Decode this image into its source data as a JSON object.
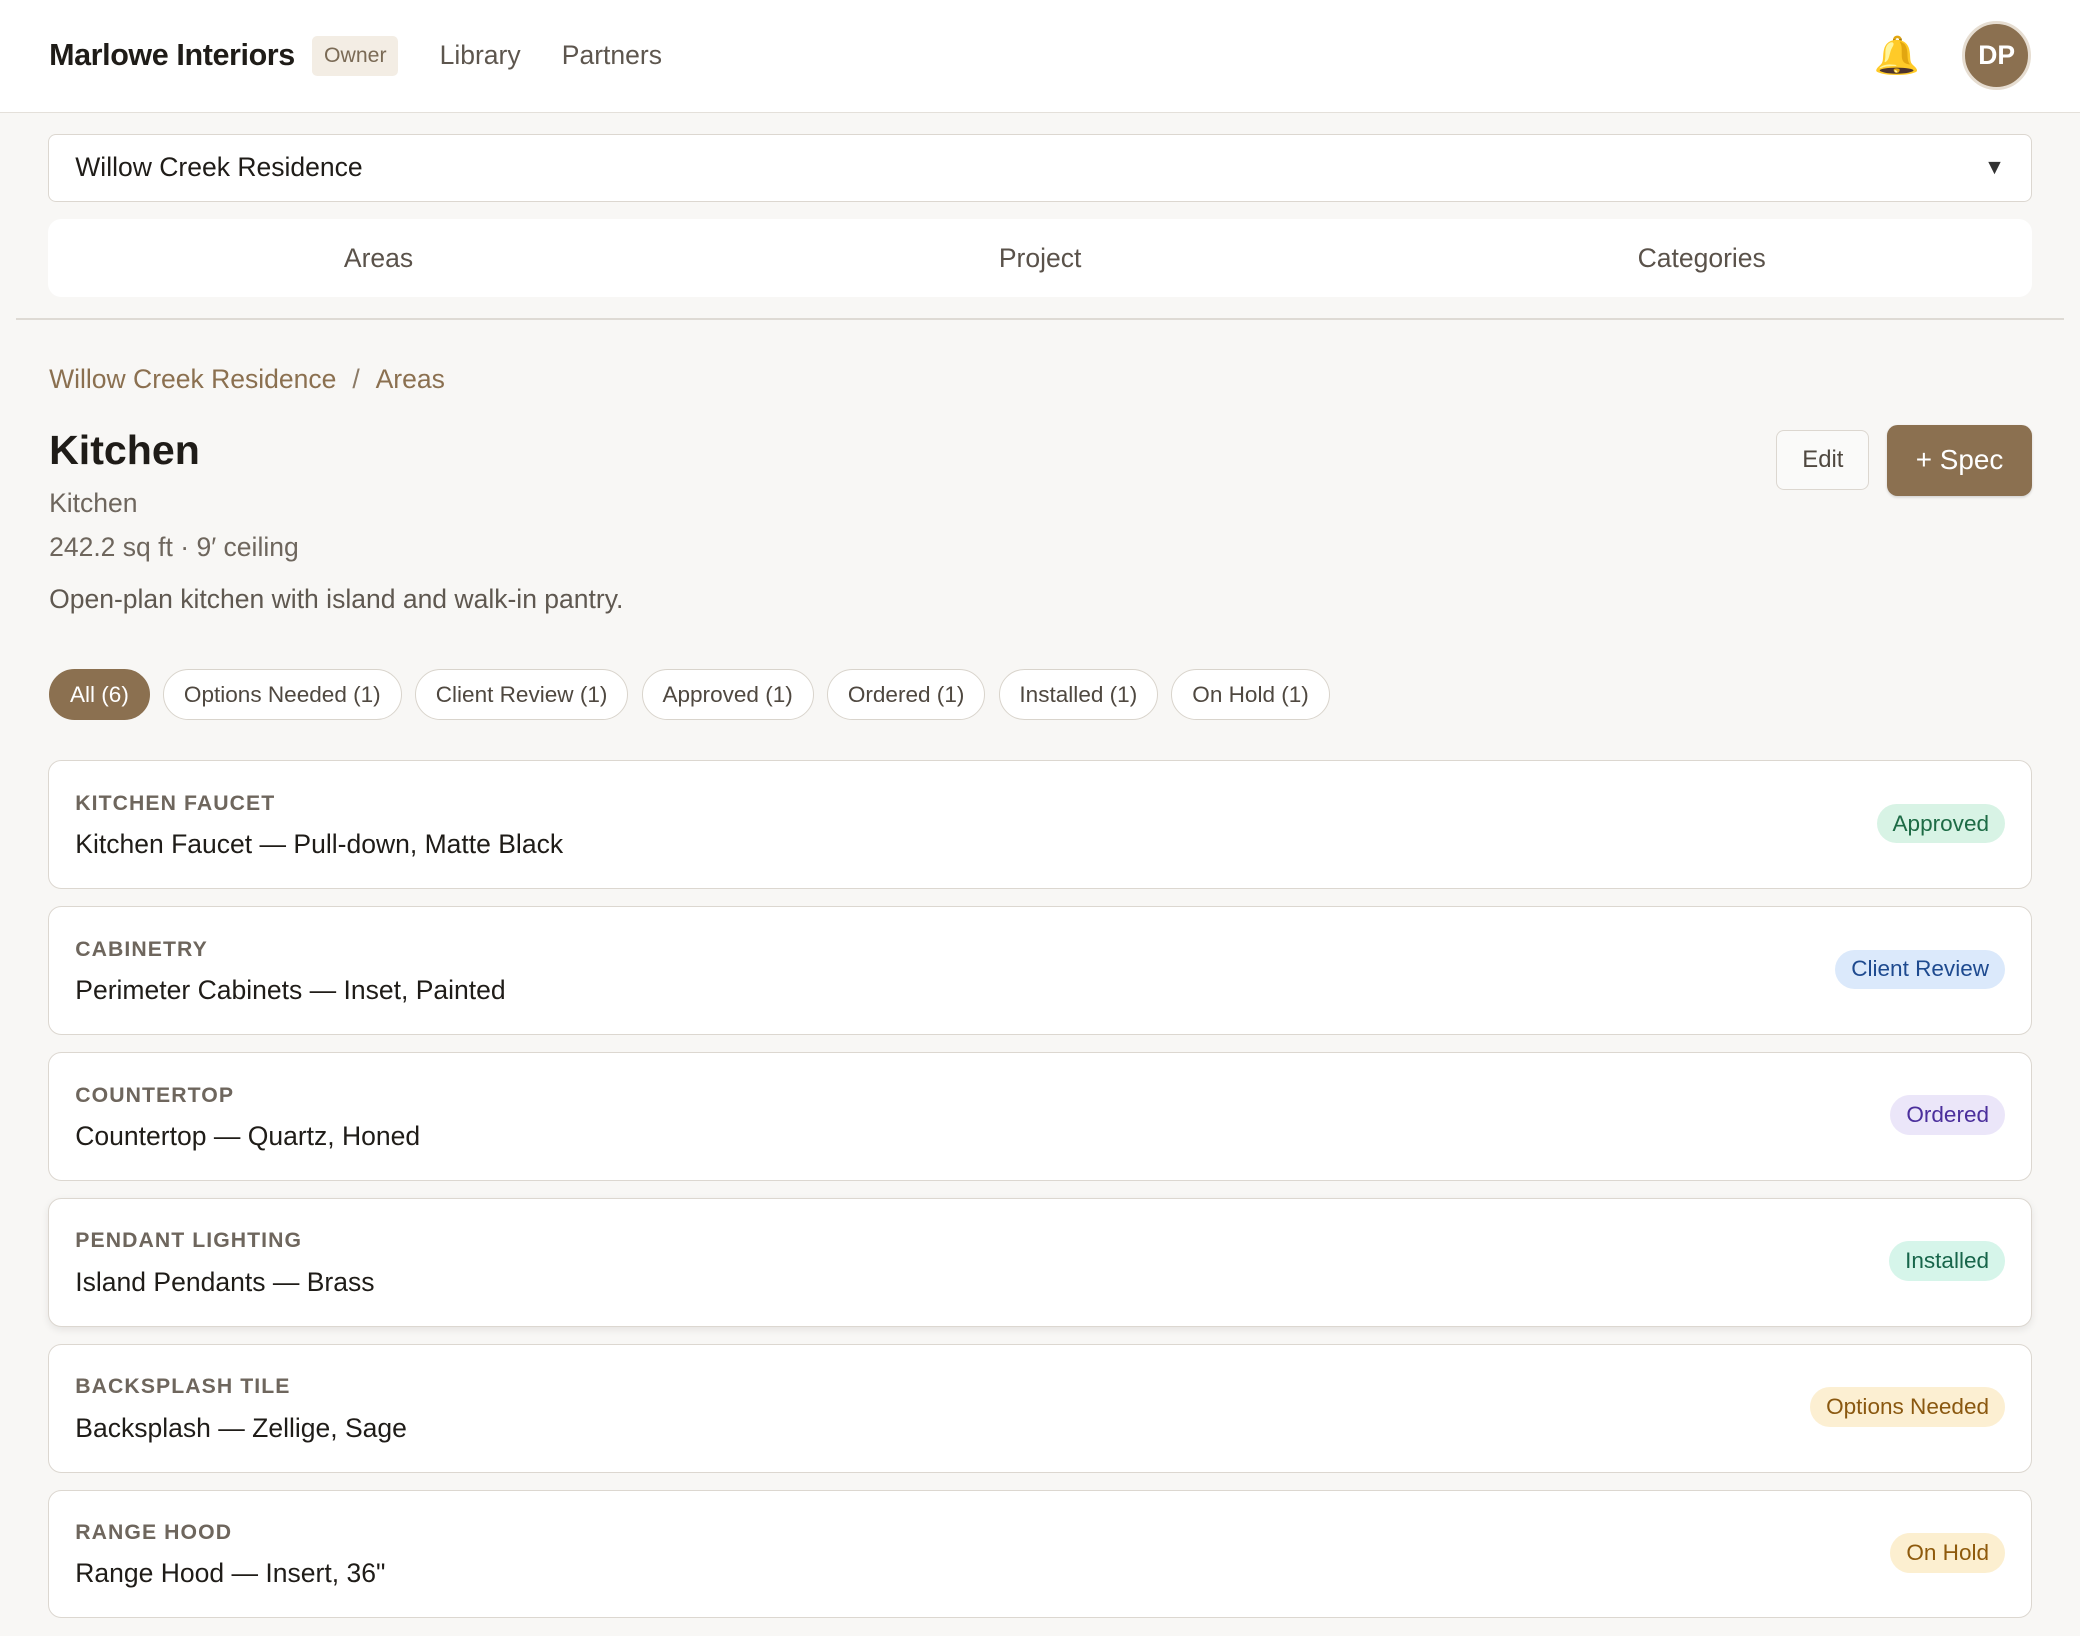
{
  "app": {
    "brand": "Marlowe Interiors",
    "role": "Owner",
    "nav": [
      "Library",
      "Partners"
    ],
    "avatar_initials": "DP",
    "bell_icon": "bell-icon"
  },
  "project_selector": {
    "value": "Willow Creek Residence",
    "caret_icon": "chevron-down-icon"
  },
  "tabs": [
    "Areas",
    "Project",
    "Categories"
  ],
  "breadcrumb": {
    "project": "Willow Creek Residence",
    "separator": "/",
    "section": "Areas"
  },
  "area": {
    "title": "Kitchen",
    "type": "Kitchen",
    "dimensions": "242.2 sq ft · 9′ ceiling",
    "description": "Open-plan kitchen with island and walk-in pantry."
  },
  "actions": {
    "edit": "Edit",
    "add_spec": "+ Spec"
  },
  "filters": [
    {
      "label": "All (6)",
      "active": true
    },
    {
      "label": "Options Needed (1)",
      "active": false
    },
    {
      "label": "Client Review (1)",
      "active": false
    },
    {
      "label": "Approved (1)",
      "active": false
    },
    {
      "label": "Ordered (1)",
      "active": false
    },
    {
      "label": "Installed (1)",
      "active": false
    },
    {
      "label": "On Hold (1)",
      "active": false
    }
  ],
  "specs": [
    {
      "category": "KITCHEN FAUCET",
      "name": "Kitchen Faucet — Pull-down, Matte Black",
      "status": "Approved"
    },
    {
      "category": "CABINETRY",
      "name": "Perimeter Cabinets — Inset, Painted",
      "status": "Client Review"
    },
    {
      "category": "COUNTERTOP",
      "name": "Countertop — Quartz, Honed",
      "status": "Ordered"
    },
    {
      "category": "PENDANT LIGHTING",
      "name": "Island Pendants — Brass",
      "status": "Installed"
    },
    {
      "category": "BACKSPLASH TILE",
      "name": "Backsplash — Zellige, Sage",
      "status": "Options Needed"
    },
    {
      "category": "RANGE HOOD",
      "name": "Range Hood — Insert, 36\"",
      "status": "On Hold"
    }
  ],
  "colors": {
    "accent": "#8b7050",
    "approved": "#1d6b45",
    "client_review": "#1e4a8f",
    "ordered": "#4b2f9c",
    "installed": "#17654a",
    "options_needed": "#8a5810",
    "on_hold": "#8e5a0c"
  }
}
